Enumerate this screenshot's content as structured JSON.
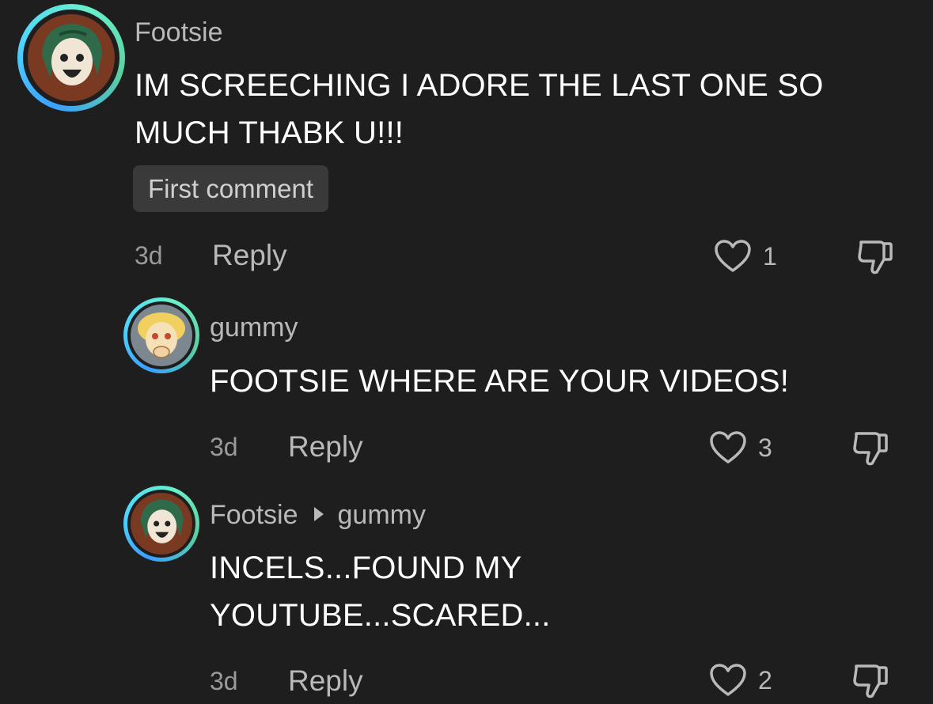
{
  "colors": {
    "background": "#1e1e1e",
    "text_primary": "#ffffff",
    "text_secondary": "#b9b9b9",
    "badge_bg": "#3a3a3a",
    "avatar_ring_gradient": [
      "#3aa0ff",
      "#6af0c8"
    ]
  },
  "comments": [
    {
      "username": "Footsie",
      "text_lines": [
        "IM SCREECHING I ADORE THE LAST ONE SO",
        "MUCH THABK U!!!"
      ],
      "badge": "First comment",
      "time": "3d",
      "reply_label": "Reply",
      "like_count": "1",
      "icons": {
        "like": "heart-outline-icon",
        "dislike": "thumbs-down-icon"
      }
    },
    {
      "username": "gummy",
      "text_lines": [
        "FOOTSIE WHERE ARE YOUR VIDEOS!"
      ],
      "time": "3d",
      "reply_label": "Reply",
      "like_count": "3",
      "icons": {
        "like": "heart-outline-icon",
        "dislike": "thumbs-down-icon"
      }
    },
    {
      "username": "Footsie",
      "reply_to": "gummy",
      "text_lines": [
        "INCELS...FOUND MY",
        "YOUTUBE...SCARED..."
      ],
      "time": "3d",
      "reply_label": "Reply",
      "like_count": "2",
      "icons": {
        "like": "heart-outline-icon",
        "dislike": "thumbs-down-icon",
        "reply_arrow": "triangle-right-icon"
      }
    }
  ]
}
